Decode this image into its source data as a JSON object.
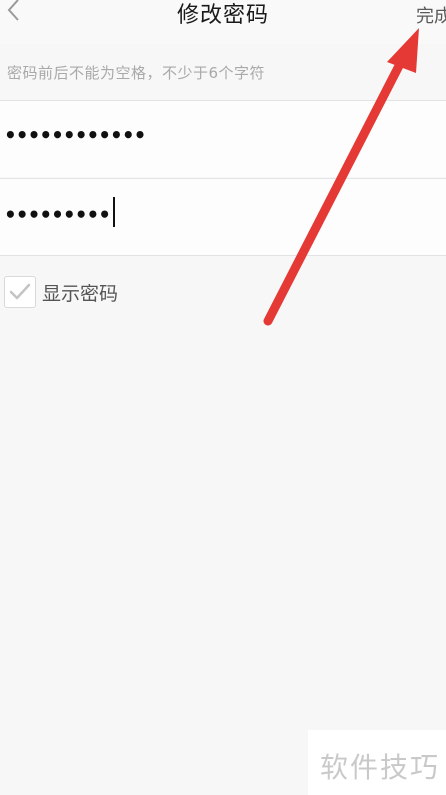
{
  "header": {
    "title": "修改密码",
    "done_label": "完成"
  },
  "form": {
    "hint": "密码前后不能为空格，不少于6个字符",
    "password_1": "••••••••••••",
    "password_2": "•••••••••"
  },
  "options": {
    "show_password_label": "显示密码"
  },
  "watermark": {
    "text": "软件技巧"
  },
  "colors": {
    "annotation_arrow": "#e53935"
  },
  "icons": {
    "back": "chevron-left-icon",
    "checkbox": "checkmark-icon"
  }
}
